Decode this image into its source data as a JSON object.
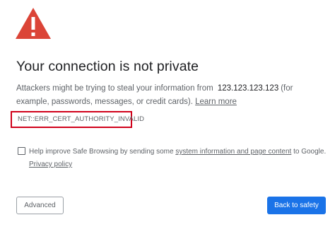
{
  "icon": {
    "name": "warning-triangle-icon",
    "color": "#db4437"
  },
  "heading": "Your connection is not private",
  "message": {
    "before_ip": "Attackers might be trying to steal your information from",
    "ip": "123.123.123.123",
    "after_ip": "(for example, passwords, messages, or credit cards).",
    "learn_more": "Learn more"
  },
  "error_code": "NET::ERR_CERT_AUTHORITY_INVALID",
  "safe_browsing": {
    "checked": false,
    "before_link": "Help improve Safe Browsing by sending some",
    "link": "system information and page content",
    "after_link": "to Google.",
    "privacy_link": "Privacy policy"
  },
  "buttons": {
    "advanced": "Advanced",
    "back": "Back to safety"
  },
  "colors": {
    "accent": "#1a73e8",
    "highlight_border": "#d0021b",
    "text": "#5f6368",
    "heading": "#202124"
  }
}
